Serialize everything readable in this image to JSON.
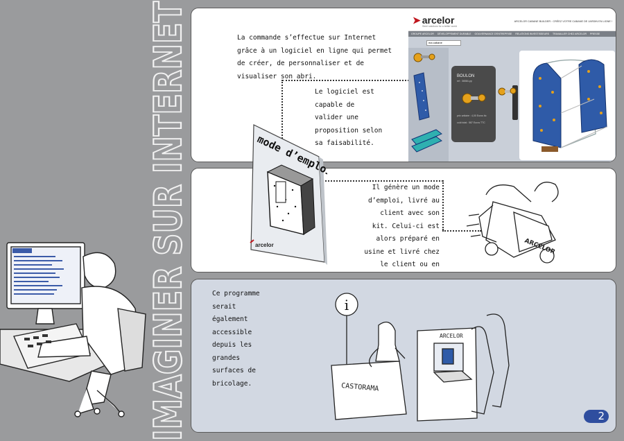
{
  "vertical_title": "IMAGINER SUR INTERNET",
  "panel1": {
    "text_main": "La commande s’effectue sur Internet grâce à un logiciel en ligne qui permet de créer, de personnaliser et de visualiser son abri.",
    "text_validate": "Le logiciel est capable de valider une proposition selon sa faisabilité.",
    "website": {
      "logo": "arcelor",
      "tagline": "Steel solutions for a better world",
      "site_title": "ARCELOR CABANE BUILDER : CRÉEZ VOTRE CABANE DE JARDIN EN LIGNE !",
      "nav": [
        "GROUPE ARCELOR",
        "DÉVELOPPEMENT DURABLE",
        "GOUVERNANCE D'ENTREPRISE",
        "RELATIONS INVESTISSEURS",
        "TRAVAILLER CHEZ ARCELOR",
        "PRESSE"
      ],
      "search_value": "ma cabane",
      "card_name": "BOULON",
      "card_ref": "ref : 36584-pp",
      "card_price": "prix unitaire : 4,00 Euros ttc",
      "card_total": "coût total : 587 Euros TTC"
    }
  },
  "panel2": {
    "manual_title": "mode d’emploi",
    "manual_logo": "arcelor",
    "text": "Il génère un mode d’emploi, livré au client avec son kit. Celui-ci est alors préparé en usine et livré chez le client ou en magasin.",
    "truck_label": "ARCELOR"
  },
  "panel3": {
    "text": "Ce programme serait également accessible depuis les grandes surfaces de bricolage.",
    "info_sign": "i",
    "counter_label": "CASTORAMA",
    "kiosk_label": "ARCELOR"
  },
  "page_number": "2",
  "colors": {
    "background": "#9a9b9d",
    "panel3_bg": "#d2d8e2",
    "badge": "#2f4e9f",
    "structure_blue": "#2f5ba8",
    "bolt_orange": "#e5a11b"
  }
}
